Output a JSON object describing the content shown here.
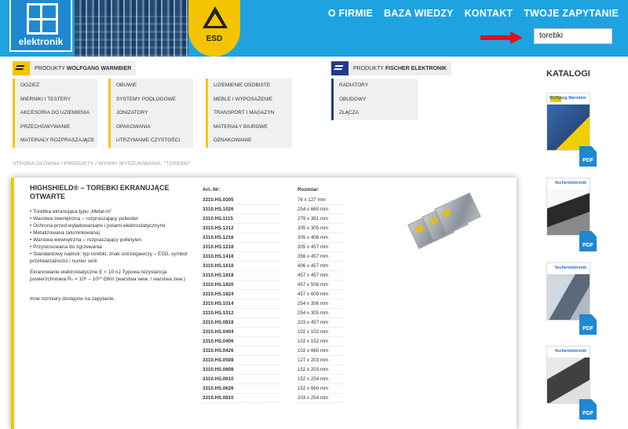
{
  "header": {
    "logo_text": "elektronik",
    "esd_label": "ESD",
    "nav": [
      "O FIRMIE",
      "BAZA WIEDZY",
      "KONTAKT",
      "TWOJE ZAPYTANIE"
    ],
    "search_value": "torebki"
  },
  "warmbier": {
    "heading_prefix": "PRODUKTY",
    "heading_brand": "WOLFGANG WARMBIER",
    "col1": [
      "OOZIEŻ",
      "MIERNIKI I TESTERY",
      "AKCESORIA DO UZIEMIENIA",
      "PRZECHOWYWANIE",
      "MATERIAŁY ROZPRASZAJĄCE"
    ],
    "col2": [
      "OBUWIE",
      "SYSTEMY PODŁOGOWE",
      "JONIZATORY",
      "OPAKOWANIA",
      "UTRZYMANIE CZYSTOŚCI"
    ],
    "col3": [
      "UZIEMIENIE OSOBISTE",
      "MEBLE I WYPOSAŻENIE",
      "TRANSPORT I MAGAZYN",
      "MATERIAŁY BIUROWE",
      "OZNAKOWANIE"
    ]
  },
  "fischer": {
    "heading_prefix": "PRODUKTY",
    "heading_brand": "FISCHER ELEKTRONIK",
    "items": [
      "RADIATORY",
      "OBUDOWY",
      "ZŁĄCZA"
    ]
  },
  "katalogi": {
    "title": "KATALOGI",
    "pdf_label": "PDF",
    "kat1_brand": "Wolfgang Warmbier",
    "kat_brand": "fischerelektronik"
  },
  "breadcrumb": "STRONA GŁÓWNA / PRODUKTY / WYNIKI WYSZUKIWANIA: \"TOREBKI\"",
  "product": {
    "title": "HIGHSHIELD® – TOREBKI EKRANUJĄCE OTWARTE",
    "bullets": [
      "• Torebka ekranująca typu „Metal-In”",
      "• Warstwa zewnętrzna – rozpraszający poliester",
      "• Ochrona przed wyładowaniami i polami elektrostatycznymi",
      "• Metalizowana (aluminiowana)",
      "• Warstwa wewnętrzna – rozpraszający polietylen",
      "• Przystosowana do zgrzewania",
      "• Standardowy nadruk: typ torebki, znak ostrzegawczy – ESD, symbol przetwarzalności i numer serii"
    ],
    "note": "Ekranowanie elektrostatyczne E < 10 nJ Typowa rezystancja powierzchniowa Rₛ = 10⁹ – 10¹⁰ Ohm (warstwa wew. / warstwa zew.)",
    "more": "Inne rozmiary dostępne na zapytanie.",
    "col_art": "Art.-Nr:",
    "col_size": "Rozmiar:",
    "articles": [
      "3310.HS.0305",
      "3310.HS.1026",
      "3310.HS.1115",
      "3310.HS.1212",
      "3310.HS.1216",
      "3310.HS.1218",
      "3310.HS.1418",
      "3310.HS.1618",
      "3310.HS.1818",
      "3310.HS.1820",
      "3310.HS.1824",
      "3310.HS.1014",
      "3310.HS.1012",
      "3310.HS.0818",
      "3310.HS.0404",
      "3310.HS.0406",
      "3310.HS.0426",
      "3310.HS.0508",
      "3310.HS.0608",
      "3310.HS.0610",
      "3310.HS.0626",
      "3310.HS.0810"
    ],
    "sizes": [
      "76 x 127 mm",
      "254 x 660 mm",
      "279 x 381 mm",
      "305 x 305 mm",
      "305 x 406 mm",
      "305 x 457 mm",
      "356 x 457 mm",
      "406 x 457 mm",
      "457 x 457 mm",
      "457 x 508 mm",
      "457 x 609 mm",
      "254 x 356 mm",
      "254 x 305 mm",
      "203 x 457 mm",
      "102 x 102 mm",
      "102 x 152 mm",
      "102 x 660 mm",
      "127 x 203 mm",
      "152 x 203 mm",
      "152 x 254 mm",
      "152 x 660 mm",
      "203 x 254 mm"
    ]
  }
}
